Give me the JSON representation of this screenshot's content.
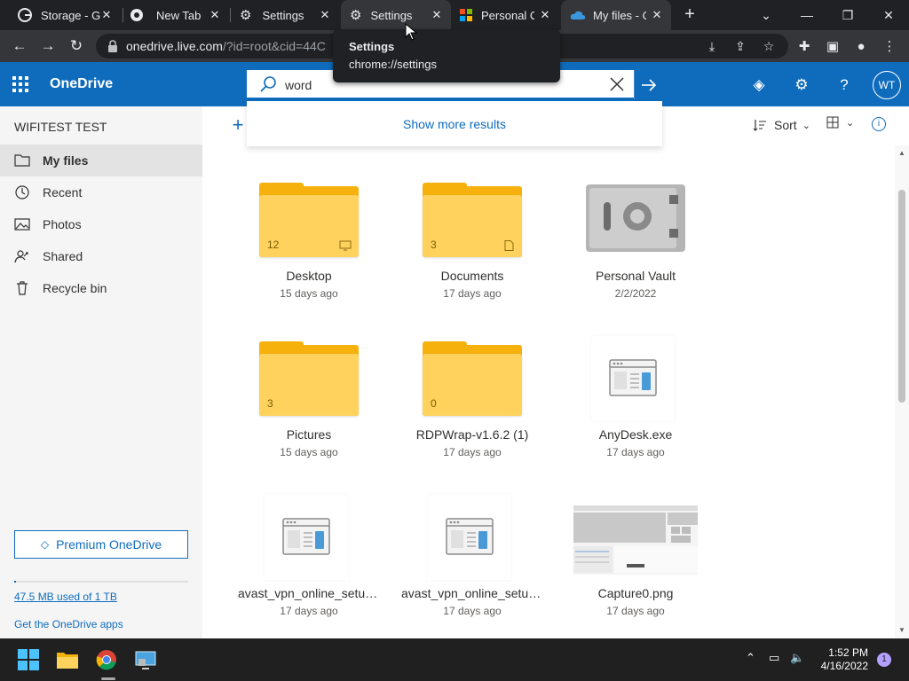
{
  "browser": {
    "tabs": [
      {
        "title": "Storage - G",
        "icon": "google-icon"
      },
      {
        "title": "New Tab",
        "icon": "chrome-icon"
      },
      {
        "title": "Settings",
        "icon": "gear-icon"
      },
      {
        "title": "Settings",
        "icon": "gear-icon"
      },
      {
        "title": "Personal Cl",
        "icon": "microsoft-icon"
      },
      {
        "title": "My files - O",
        "icon": "onedrive-icon"
      }
    ],
    "new_tab_label": "+",
    "url_host": "onedrive.live.com",
    "url_path": "/?id=root&cid=44C",
    "tooltip": {
      "title": "Settings",
      "url": "chrome://settings"
    }
  },
  "header": {
    "brand": "OneDrive",
    "search_value": "word",
    "avatar_initials": "WT",
    "show_more": "Show more results"
  },
  "sidebar": {
    "account": "WIFITEST TEST",
    "items": [
      {
        "label": "My files",
        "icon": "folder-icon"
      },
      {
        "label": "Recent",
        "icon": "clock-icon"
      },
      {
        "label": "Photos",
        "icon": "image-icon"
      },
      {
        "label": "Shared",
        "icon": "people-icon"
      },
      {
        "label": "Recycle bin",
        "icon": "trash-icon"
      }
    ],
    "premium_label": "Premium OneDrive",
    "storage_text": "47.5 MB used of 1 TB",
    "storage_fraction": 4.75e-05,
    "apps_link": "Get the OneDrive apps"
  },
  "command_bar": {
    "sort_label": "Sort"
  },
  "files": [
    {
      "name": "Desktop",
      "date": "15 days ago",
      "type": "folder",
      "count": "12",
      "badge": "monitor-icon"
    },
    {
      "name": "Documents",
      "date": "17 days ago",
      "type": "folder",
      "count": "3",
      "badge": "document-icon"
    },
    {
      "name": "Personal Vault",
      "date": "2/2/2022",
      "type": "vault"
    },
    {
      "name": "Pictures",
      "date": "15 days ago",
      "type": "folder",
      "count": "3"
    },
    {
      "name": "RDPWrap-v1.6.2 (1)",
      "date": "17 days ago",
      "type": "folder",
      "count": "0"
    },
    {
      "name": "AnyDesk.exe",
      "date": "17 days ago",
      "type": "app"
    },
    {
      "name": "avast_vpn_online_setup.exe",
      "date": "17 days ago",
      "type": "app"
    },
    {
      "name": "avast_vpn_online_setup.exe",
      "date": "17 days ago",
      "type": "app"
    },
    {
      "name": "Capture0.png",
      "date": "17 days ago",
      "type": "image"
    }
  ],
  "taskbar": {
    "time": "1:52 PM",
    "date": "4/16/2022",
    "notification_count": "1"
  },
  "colors": {
    "onedrive_blue": "#0f6cbd",
    "folder_front": "#ffd25d",
    "folder_back": "#f6b10d",
    "chrome_dark": "#202124"
  }
}
